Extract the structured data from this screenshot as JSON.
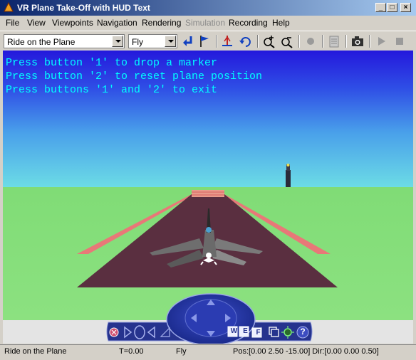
{
  "window": {
    "title": "VR Plane Take-Off with HUD Text"
  },
  "menu": [
    "File",
    "View",
    "Viewpoints",
    "Navigation",
    "Rendering",
    "Simulation",
    "Recording",
    "Help"
  ],
  "toolbar": {
    "viewpoint": "Ride on the Plane",
    "nav_mode": "Fly"
  },
  "hud": {
    "line1": "Press button '1' to drop a marker",
    "line2": "Press button '2' to reset plane position",
    "line3": "Press buttons '1' and '2' to exit"
  },
  "navpanel": {
    "w": "W",
    "e": "E",
    "f": "F",
    "help": "?"
  },
  "status": {
    "viewpoint": "Ride on the Plane",
    "time": "T=0.00",
    "mode": "Fly",
    "position": "Pos:[0.00 2.50 -15.00] Dir:[0.00 0.00 0.50]"
  },
  "colors": {
    "sky_top": "#2a1ee0",
    "sky_horizon": "#6cd8e8",
    "ground": "#86e07a",
    "runway": "#5a2f40",
    "hud_text": "#00ffff"
  }
}
